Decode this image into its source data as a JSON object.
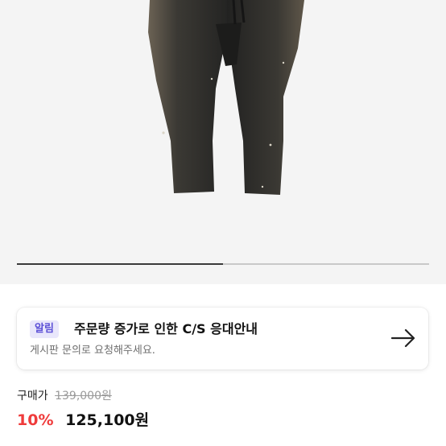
{
  "product": {
    "image_alt": "black washed denim pants",
    "carousel_progress": 0.5
  },
  "notice": {
    "badge": "알림",
    "title": "주문량 증가로 인한 C/S 응대안내",
    "subtitle": "게시판 문의로 요청해주세요.",
    "icon": "arrow-right-icon"
  },
  "price": {
    "label": "구매가",
    "original": "139,000원",
    "discount": "10%",
    "final": "125,100원"
  },
  "colors": {
    "badge_bg": "#e9e7fb",
    "badge_text": "#5b4fd6",
    "discount": "#ef3b3b"
  }
}
